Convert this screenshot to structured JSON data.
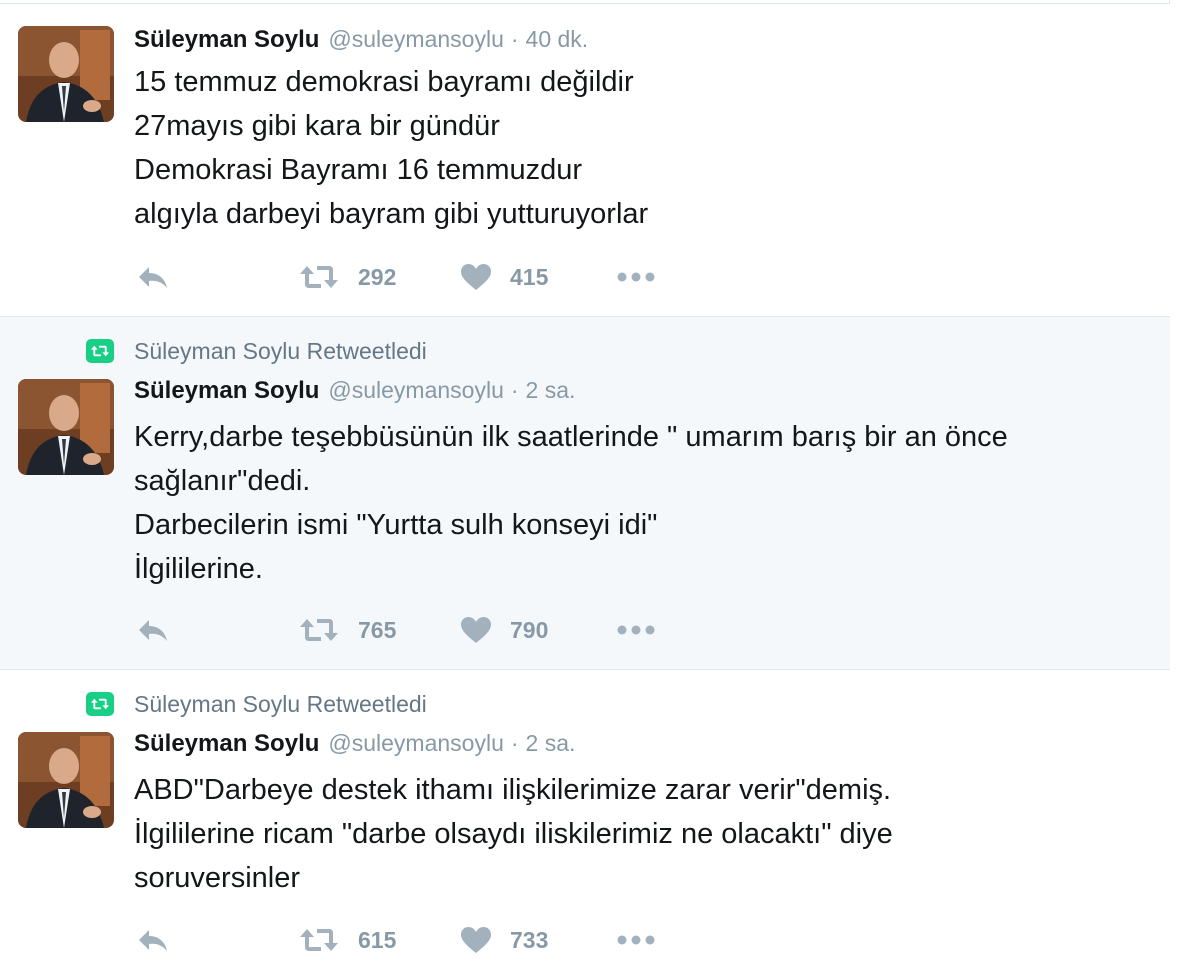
{
  "timeline": {
    "tweets": [
      {
        "retweet_label": "",
        "author_name": "Süleyman Soylu",
        "handle": "@suleymansoylu",
        "separator": "·",
        "time": "40 dk.",
        "lines": [
          "15 temmuz demokrasi bayramı değildir",
          "27mayıs gibi kara bir gündür",
          "Demokrasi Bayramı 16 temmuzdur",
          "algıyla darbeyi bayram gibi yutturuyorlar"
        ],
        "retweet_count": "292",
        "like_count": "415"
      },
      {
        "retweet_label": "Süleyman Soylu Retweetledi",
        "author_name": "Süleyman Soylu",
        "handle": "@suleymansoylu",
        "separator": "·",
        "time": "2 sa.",
        "lines": [
          "Kerry,darbe teşebbüsünün ilk saatlerinde \" umarım barış bir an önce",
          "sağlanır\"dedi.",
          "Darbecilerin ismi \"Yurtta sulh konseyi idi\"",
          "İlgililerine."
        ],
        "retweet_count": "765",
        "like_count": "790"
      },
      {
        "retweet_label": "Süleyman Soylu Retweetledi",
        "author_name": "Süleyman Soylu",
        "handle": "@suleymansoylu",
        "separator": "·",
        "time": "2 sa.",
        "lines": [
          "ABD\"Darbeye destek ithamı ilişkilerimize zarar verir\"demiş.",
          "İlgililerine ricam \"darbe olsaydı iliskilerimiz ne olacaktı\" diye",
          "soruversinler"
        ],
        "retweet_count": "615",
        "like_count": "733"
      }
    ]
  },
  "icons": {
    "reply": "reply-icon",
    "retweet": "retweet-icon",
    "like": "heart-icon",
    "more": "more-dots-icon"
  },
  "colors": {
    "name": "#14171a",
    "meta": "#8899a6",
    "action": "#a3b1bd",
    "retweet_badge": "#19cf86",
    "highlight_background": "#f5f8fa",
    "divider": "#e1e8ed"
  }
}
